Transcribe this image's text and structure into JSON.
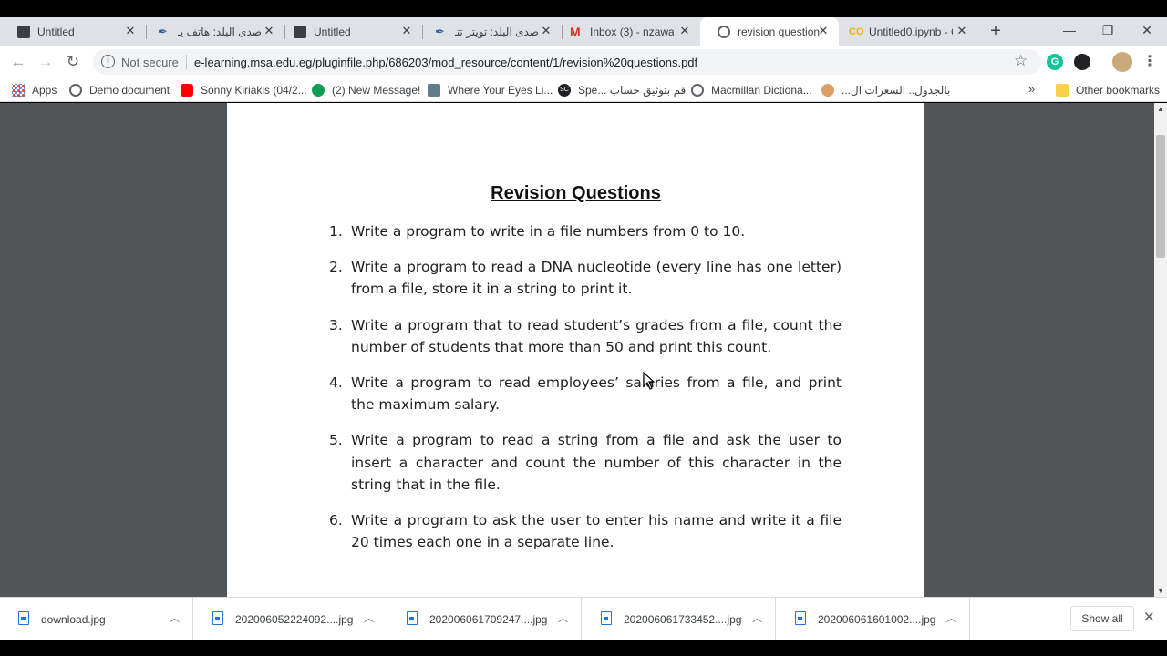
{
  "tabs": [
    {
      "title": "Untitled",
      "icon": "document-icon",
      "active": false
    },
    {
      "title": "صدى البلد: هاتف يـ",
      "icon": "feather-icon",
      "active": false
    },
    {
      "title": "Untitled",
      "icon": "document-icon",
      "active": false
    },
    {
      "title": "صدى البلد: تويتر تتـ",
      "icon": "feather-icon",
      "active": false
    },
    {
      "title": "Inbox (3) - nzawa",
      "icon": "gmail-icon",
      "active": false
    },
    {
      "title": "revision question",
      "icon": "globe-icon",
      "active": true
    },
    {
      "title": "Untitled0.ipynb - C",
      "icon": "colab-icon",
      "active": false
    }
  ],
  "toolbar": {
    "security_label": "Not secure",
    "url": "e-learning.msa.edu.eg/pluginfile.php/686203/mod_resource/content/1/revision%20questions.pdf"
  },
  "bookmarks": [
    {
      "label": "Apps",
      "icon": "apps-grid-icon"
    },
    {
      "label": "Demo document",
      "icon": "globe-icon"
    },
    {
      "label": "Sonny Kiriakis (04/2...",
      "icon": "youtube-icon"
    },
    {
      "label": "(2) New Message!",
      "icon": "message-icon"
    },
    {
      "label": "Where Your Eyes Li...",
      "icon": "site-icon"
    },
    {
      "label": "قم بتوثيق حساب ...Spe",
      "icon": "sc-icon"
    },
    {
      "label": "Macmillan Dictiona...",
      "icon": "globe-icon"
    },
    {
      "label": "بالجدول.. السعرات ال...",
      "icon": "face-icon"
    }
  ],
  "other_bookmarks": "Other bookmarks",
  "document": {
    "title": "Revision Questions",
    "questions": [
      {
        "num": "1.",
        "text": "Write a program to write in a file numbers from 0 to 10."
      },
      {
        "num": "2.",
        "text": "Write a program to read a DNA nucleotide (every line has one letter) from a file, store it in a string to print it."
      },
      {
        "num": "3.",
        "text": "Write a program that to read student’s grades from a file, count the number of students that more than 50 and print this count."
      },
      {
        "num": "4.",
        "text": "Write a program to read employees’ salaries from a file, and print the maximum salary."
      },
      {
        "num": "5.",
        "text": "Write a program to read a string from a file and ask the user to insert a character and count the number of this character in the string that in the file."
      },
      {
        "num": "6.",
        "text": "Write a program to ask the user to enter his name and write it a file 20 times each one in a separate line."
      }
    ]
  },
  "downloads": [
    {
      "name": "download.jpg"
    },
    {
      "name": "202006052224092....jpg"
    },
    {
      "name": "202006061709247....jpg"
    },
    {
      "name": "202006061733452....jpg"
    },
    {
      "name": "202006061601002....jpg"
    }
  ],
  "show_all_label": "Show all"
}
